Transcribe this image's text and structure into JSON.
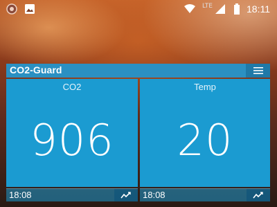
{
  "statusbar": {
    "network_label": "LTE",
    "time": "18:11",
    "left_icons": [
      "app-notification-icon",
      "image-notification-icon"
    ],
    "right_icons": [
      "wifi-icon",
      "signal-icon",
      "battery-icon"
    ]
  },
  "widget": {
    "title": "CO2-Guard",
    "accent_color": "#1b9bd1",
    "panels": [
      {
        "label": "CO2",
        "value": "906",
        "time": "18:08"
      },
      {
        "label": "Temp",
        "value": "20",
        "time": "18:08"
      }
    ]
  }
}
